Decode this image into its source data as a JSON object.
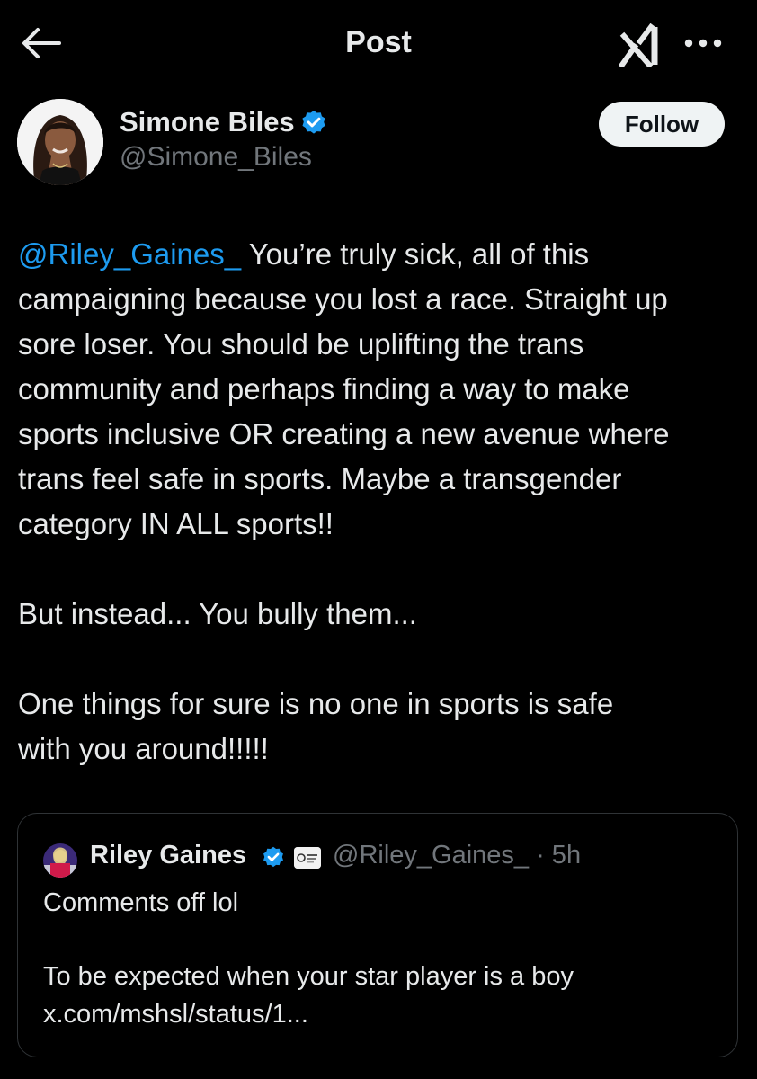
{
  "header": {
    "title": "Post",
    "back_icon": "arrow-left-icon",
    "grok_icon": "grok-icon",
    "more_icon": "more-dots-icon"
  },
  "author": {
    "name": "Simone Biles",
    "handle": "@Simone_Biles",
    "verified": true,
    "verified_color": "#1d9bf0",
    "follow_label": "Follow"
  },
  "post": {
    "mention": "@Riley_Gaines_",
    "lines": [
      " You’re truly sick, all of this",
      "campaigning because you lost a race. Straight up",
      "sore loser. You should be uplifting the trans",
      "community and perhaps finding a way to make",
      "sports inclusive OR creating a new avenue where",
      "trans feel safe in sports. Maybe a transgender",
      "category IN ALL sports!!"
    ],
    "paragraph2": "But instead... You bully them...",
    "paragraph3_lines": [
      "One things for sure is no one in sports is safe",
      "with you around!!!!!"
    ]
  },
  "quote": {
    "name": "Riley Gaines",
    "handle_time": "@Riley_Gaines_ · 5h",
    "verified": true,
    "line1": "Comments off lol",
    "line2": "To be expected when your star player is a boy",
    "link": "x.com/mshsl/status/1..."
  },
  "colors": {
    "background": "#000000",
    "text": "#e7e9ea",
    "secondary": "#71767b",
    "accent": "#1d9bf0",
    "border": "#2f3336"
  }
}
